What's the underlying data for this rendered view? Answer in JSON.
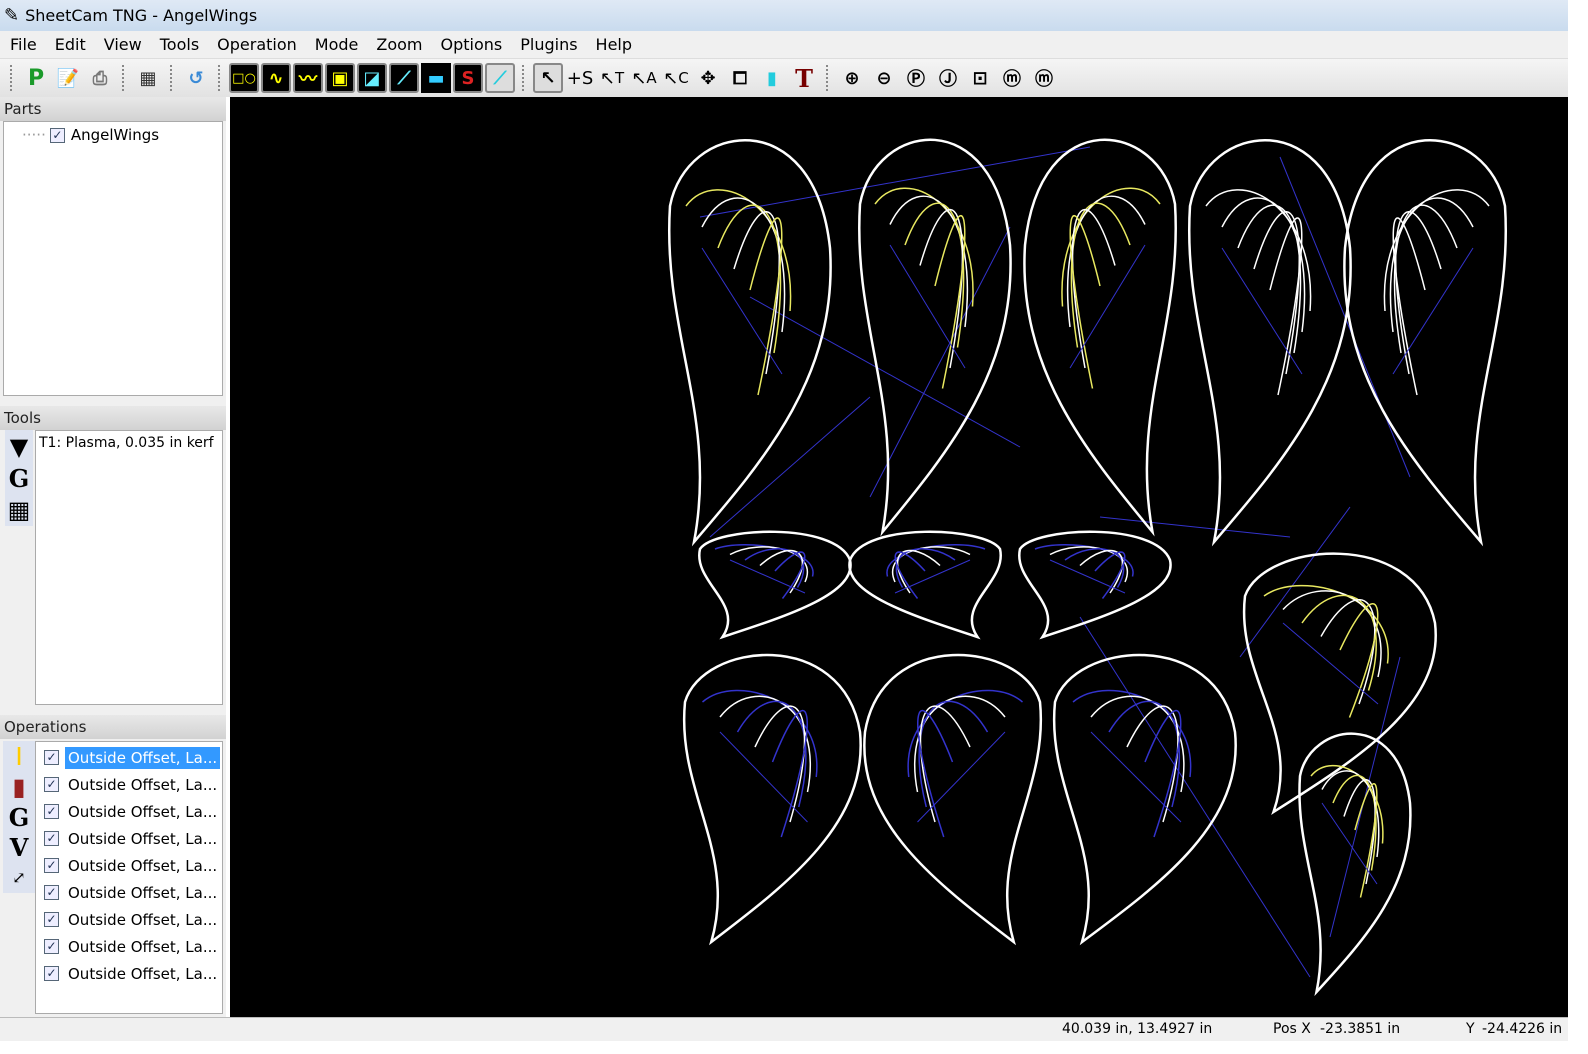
{
  "window": {
    "title": "SheetCam TNG - AngelWings"
  },
  "menu": [
    "File",
    "Edit",
    "View",
    "Tools",
    "Operation",
    "Mode",
    "Zoom",
    "Options",
    "Plugins",
    "Help"
  ],
  "toolbar": {
    "icons": [
      "post-process-icon",
      "edit-icon",
      "print-icon",
      "calculator-icon",
      "undo-icon",
      "shapes-icon",
      "path-icon",
      "path-end-icon",
      "outline-icon",
      "offset-icon",
      "lead-icon",
      "sheet-icon",
      "start-point-icon",
      "cyan-tool-icon",
      "select-icon",
      "select-start-icon",
      "select-tool-icon",
      "select-a-icon",
      "select-c-icon",
      "move-icon",
      "crop-icon",
      "cut-path-icon",
      "text-icon",
      "zoom-in-icon",
      "zoom-out-icon",
      "zoom-part-icon",
      "zoom-j-icon",
      "zoom-fit-icon",
      "zoom-m-icon",
      "zoom-mc-icon"
    ],
    "labels": {
      "p": "P",
      "t": "T",
      "s": "S",
      "st": "T",
      "sa": "A",
      "sc": "C"
    }
  },
  "parts": {
    "header": "Parts",
    "items": [
      {
        "label": "AngelWings",
        "checked": true
      }
    ]
  },
  "tools": {
    "header": "Tools",
    "items": [
      "T1: Plasma, 0.035 in kerf"
    ],
    "side_g": "G"
  },
  "operations": {
    "header": "Operations",
    "side_g": "G",
    "side_v": "V",
    "items": [
      {
        "label": "Outside Offset, La...",
        "checked": true,
        "selected": true
      },
      {
        "label": "Outside Offset, La...",
        "checked": true
      },
      {
        "label": "Outside Offset, La...",
        "checked": true
      },
      {
        "label": "Outside Offset, La...",
        "checked": true
      },
      {
        "label": "Outside Offset, La...",
        "checked": true
      },
      {
        "label": "Outside Offset, La...",
        "checked": true
      },
      {
        "label": "Outside Offset, La...",
        "checked": true
      },
      {
        "label": "Outside Offset, La...",
        "checked": true
      },
      {
        "label": "Outside Offset, La...",
        "checked": true
      }
    ]
  },
  "status": {
    "size": "40.039 in, 13.4927 in",
    "posx_label": "Pos X",
    "posx": "-23.3851 in",
    "y_label": "Y",
    "y": "-24.4226 in"
  },
  "colors": {
    "canvas": "#000000",
    "outline": "#ffffff",
    "rapid": "#3333cc",
    "lead": "#cc2222",
    "inner": "#e8e860",
    "selection": "#3399ff"
  }
}
